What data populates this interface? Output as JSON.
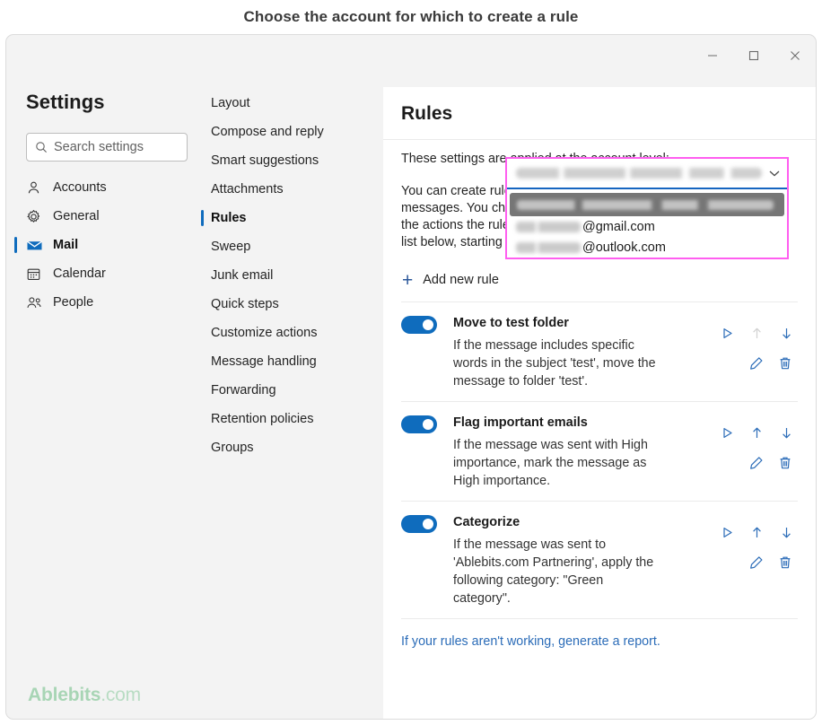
{
  "caption": "Choose the account for which to create a rule",
  "window": {
    "controls": [
      {
        "name": "minimize",
        "glyph": "minimize-icon"
      },
      {
        "name": "maximize",
        "glyph": "maximize-icon"
      },
      {
        "name": "close",
        "glyph": "close-icon"
      }
    ]
  },
  "settings": {
    "title": "Settings",
    "search": {
      "placeholder": "Search settings",
      "value": "",
      "icon": "search-icon"
    },
    "items": [
      {
        "label": "Accounts",
        "icon": "person-icon",
        "active": false
      },
      {
        "label": "General",
        "icon": "gear-icon",
        "active": false
      },
      {
        "label": "Mail",
        "icon": "mail-icon",
        "active": true
      },
      {
        "label": "Calendar",
        "icon": "calendar-icon",
        "active": false
      },
      {
        "label": "People",
        "icon": "people-icon",
        "active": false
      }
    ]
  },
  "subnav": {
    "items": [
      {
        "label": "Layout",
        "active": false
      },
      {
        "label": "Compose and reply",
        "active": false
      },
      {
        "label": "Smart suggestions",
        "active": false
      },
      {
        "label": "Attachments",
        "active": false
      },
      {
        "label": "Rules",
        "active": true
      },
      {
        "label": "Sweep",
        "active": false
      },
      {
        "label": "Junk email",
        "active": false
      },
      {
        "label": "Quick steps",
        "active": false
      },
      {
        "label": "Customize actions",
        "active": false
      },
      {
        "label": "Message handling",
        "active": false
      },
      {
        "label": "Forwarding",
        "active": false
      },
      {
        "label": "Retention policies",
        "active": false
      },
      {
        "label": "Groups",
        "active": false
      }
    ]
  },
  "main": {
    "title": "Rules",
    "intro_paragraph_1": "These settings are applied at the account level:",
    "intro_paragraph_2": "You can create rules that tell Outlook how to handle incoming email messages. You choose both the conditions that trigger a rule and the actions the rule will take. Rules will run in the order shown in the list below, starting with the rule at the top.",
    "add_rule_label": "Add new rule",
    "add_rule_icon": "plus-icon",
    "footer_link": "If your rules aren't working, generate a report."
  },
  "account_picker": {
    "selected_value": "",
    "selected_value_redacted": true,
    "chevron_icon": "chevron-down-icon",
    "options": [
      {
        "label": "",
        "redacted": true,
        "highlighted": true
      },
      {
        "label": "@gmail.com",
        "redacted_prefix": true,
        "highlighted": false
      },
      {
        "label": "@outlook.com",
        "redacted_prefix": true,
        "highlighted": false
      }
    ],
    "highlight_border_color": "#ff5ef0",
    "focus_underline_color": "#1565c0"
  },
  "rules": [
    {
      "enabled": true,
      "name": "Move to test folder",
      "description": "If the message includes specific words in the subject 'test', move the message to folder 'test'.",
      "actions": {
        "run": {
          "icon": "play-icon",
          "enabled": true
        },
        "up": {
          "icon": "arrow-up-icon",
          "enabled": false
        },
        "down": {
          "icon": "arrow-down-icon",
          "enabled": true
        },
        "edit": {
          "icon": "pencil-icon",
          "enabled": true
        },
        "delete": {
          "icon": "trash-icon",
          "enabled": true
        }
      }
    },
    {
      "enabled": true,
      "name": "Flag important emails",
      "description": "If the message was sent with High importance, mark the message as High importance.",
      "actions": {
        "run": {
          "icon": "play-icon",
          "enabled": true
        },
        "up": {
          "icon": "arrow-up-icon",
          "enabled": true
        },
        "down": {
          "icon": "arrow-down-icon",
          "enabled": true
        },
        "edit": {
          "icon": "pencil-icon",
          "enabled": true
        },
        "delete": {
          "icon": "trash-icon",
          "enabled": true
        }
      }
    },
    {
      "enabled": true,
      "name": "Categorize",
      "description": "If the message was sent to 'Ablebits.com Partnering', apply the following category: \"Green category\".",
      "actions": {
        "run": {
          "icon": "play-icon",
          "enabled": true
        },
        "up": {
          "icon": "arrow-up-icon",
          "enabled": true
        },
        "down": {
          "icon": "arrow-down-icon",
          "enabled": true
        },
        "edit": {
          "icon": "pencil-icon",
          "enabled": true
        },
        "delete": {
          "icon": "trash-icon",
          "enabled": true
        }
      }
    }
  ],
  "watermark": {
    "bold": "Ablebits",
    "light": ".com"
  },
  "colors": {
    "accent": "#0f6cbd",
    "link": "#2b6cb8",
    "highlight": "#ff5ef0",
    "watermark": "#a8d5b5"
  }
}
